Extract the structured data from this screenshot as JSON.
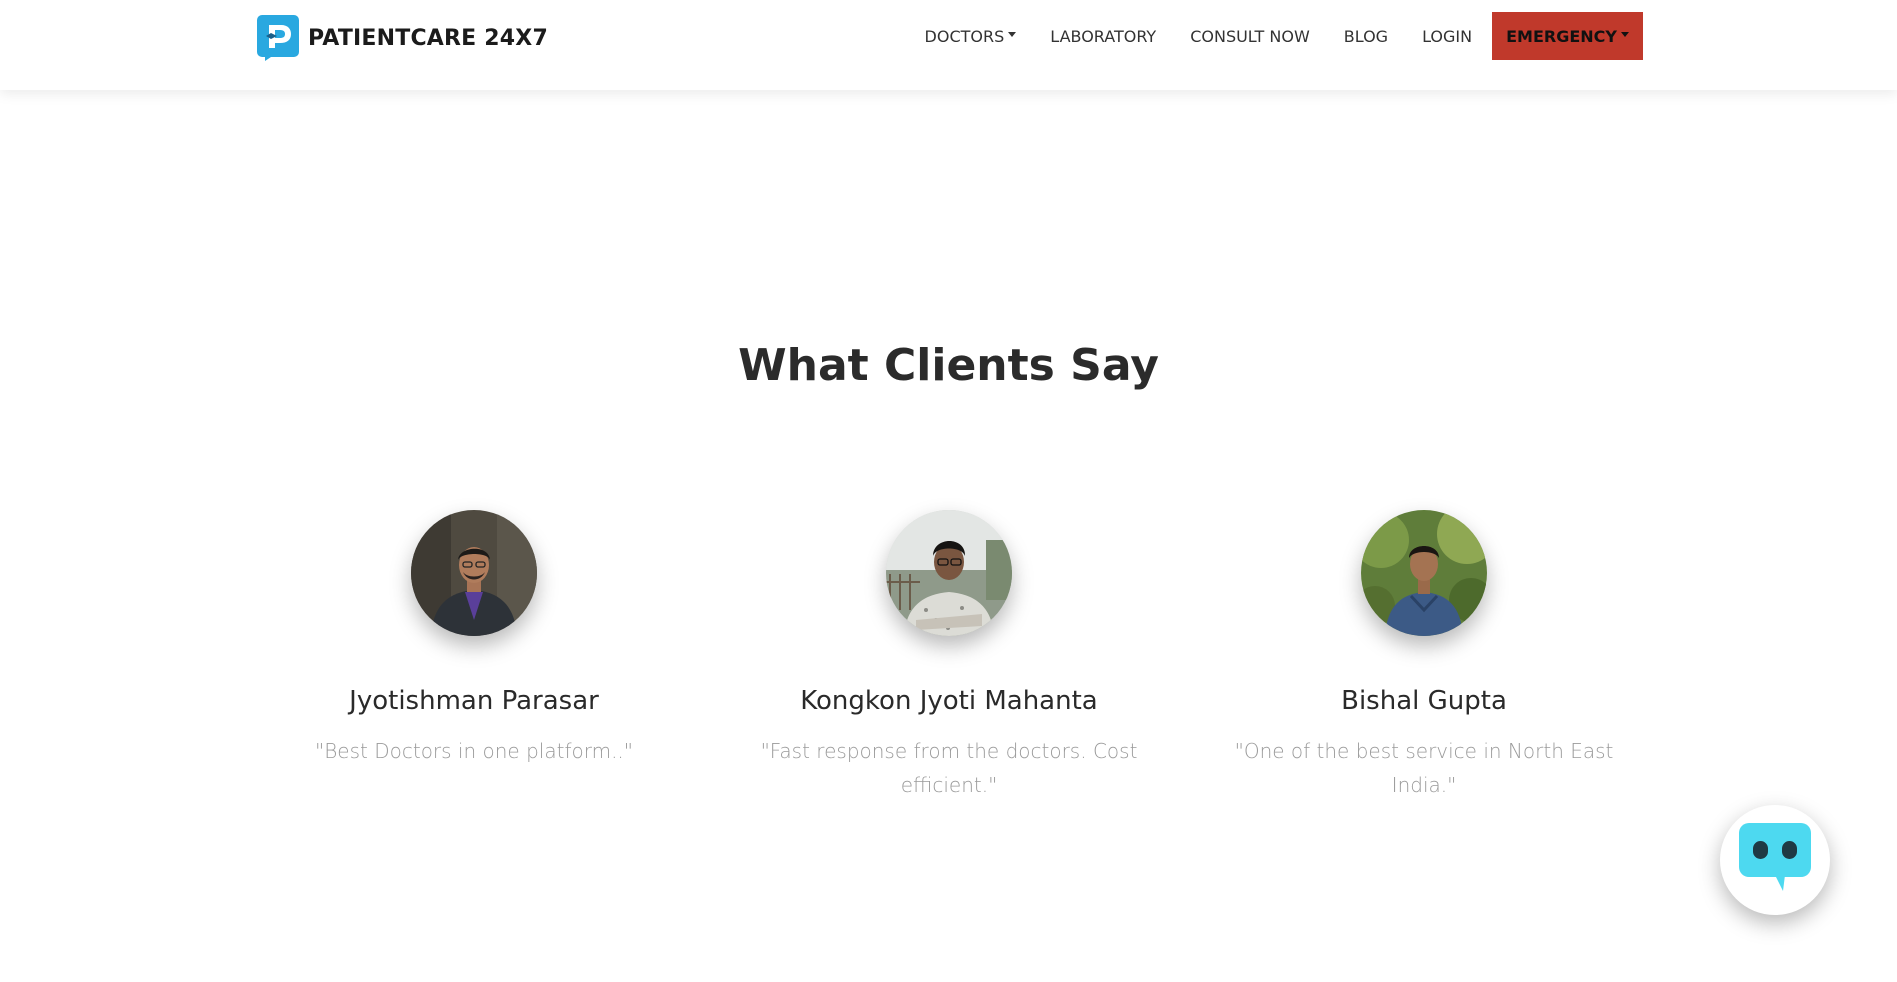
{
  "brand": {
    "name": "PATIENTCARE 24X7",
    "logo_color": "#29a8e0"
  },
  "nav": {
    "items": [
      {
        "label": "DOCTORS",
        "dropdown": true
      },
      {
        "label": "LABORATORY",
        "dropdown": false
      },
      {
        "label": "CONSULT NOW",
        "dropdown": false
      },
      {
        "label": "BLOG",
        "dropdown": false
      },
      {
        "label": "LOGIN",
        "dropdown": false
      }
    ],
    "emergency": {
      "label": "EMERGENCY",
      "color": "#c0392b"
    }
  },
  "section": {
    "title": "What Clients Say"
  },
  "testimonials": [
    {
      "name": "Jyotishman Parasar",
      "quote": "\"Best Doctors in one platform..\""
    },
    {
      "name": "Kongkon Jyoti Mahanta",
      "quote": "\"Fast response from the doctors. Cost efficient.\""
    },
    {
      "name": "Bishal Gupta",
      "quote": "\"One of the best service in North East India.\""
    }
  ],
  "chat_widget": {
    "icon": "chatbot-icon",
    "color": "#4dd9f0"
  }
}
